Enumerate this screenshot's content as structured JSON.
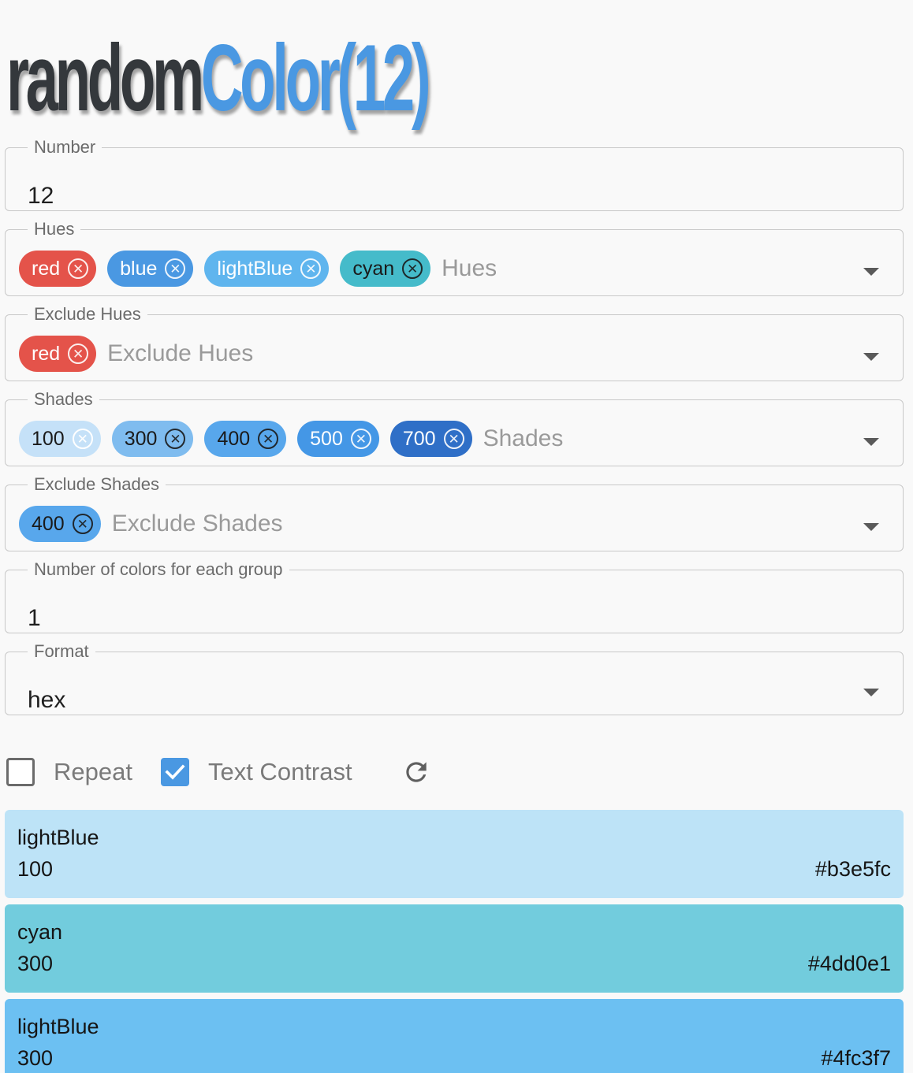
{
  "title": {
    "part1": "random",
    "part2": "Color(12)"
  },
  "number": {
    "label": "Number",
    "value": "12"
  },
  "hues": {
    "label": "Hues",
    "placeholder": "Hues",
    "chips": [
      {
        "label": "red",
        "color": "#e4534a",
        "text": "#ffffff"
      },
      {
        "label": "blue",
        "color": "#4a98e2",
        "text": "#ffffff"
      },
      {
        "label": "lightBlue",
        "color": "#5fb5ee",
        "text": "#ffffff"
      },
      {
        "label": "cyan",
        "color": "#45bbca",
        "text": "#1a1a1a"
      }
    ]
  },
  "exclude_hues": {
    "label": "Exclude Hues",
    "placeholder": "Exclude Hues",
    "chips": [
      {
        "label": "red",
        "color": "#e4534a",
        "text": "#ffffff"
      }
    ]
  },
  "shades": {
    "label": "Shades",
    "placeholder": "Shades",
    "chips": [
      {
        "label": "100",
        "color": "#c5e1f8",
        "text": "#1a1a1a"
      },
      {
        "label": "300",
        "color": "#7fbcef",
        "text": "#1a1a1a"
      },
      {
        "label": "400",
        "color": "#58a7ec",
        "text": "#1a1a1a"
      },
      {
        "label": "500",
        "color": "#4497e6",
        "text": "#ffffff"
      },
      {
        "label": "700",
        "color": "#2f6fc7",
        "text": "#ffffff"
      }
    ]
  },
  "exclude_shades": {
    "label": "Exclude Shades",
    "placeholder": "Exclude Shades",
    "chips": [
      {
        "label": "400",
        "color": "#58a7ec",
        "text": "#1a1a1a"
      }
    ]
  },
  "group_count": {
    "label": "Number of colors for each group",
    "value": "1"
  },
  "format": {
    "label": "Format",
    "value": "hex"
  },
  "controls": {
    "repeat_label": "Repeat",
    "repeat_checked": false,
    "contrast_label": "Text Contrast",
    "contrast_checked": true,
    "refresh_icon": "refresh-icon"
  },
  "colors": [
    {
      "name": "lightBlue",
      "shade": "100",
      "hex": "#b3e5fc",
      "bg": "#bde3f7"
    },
    {
      "name": "cyan",
      "shade": "300",
      "hex": "#4dd0e1",
      "bg": "#72ccdd"
    },
    {
      "name": "lightBlue",
      "shade": "300",
      "hex": "#4fc3f7",
      "bg": "#6cc0f2"
    }
  ]
}
